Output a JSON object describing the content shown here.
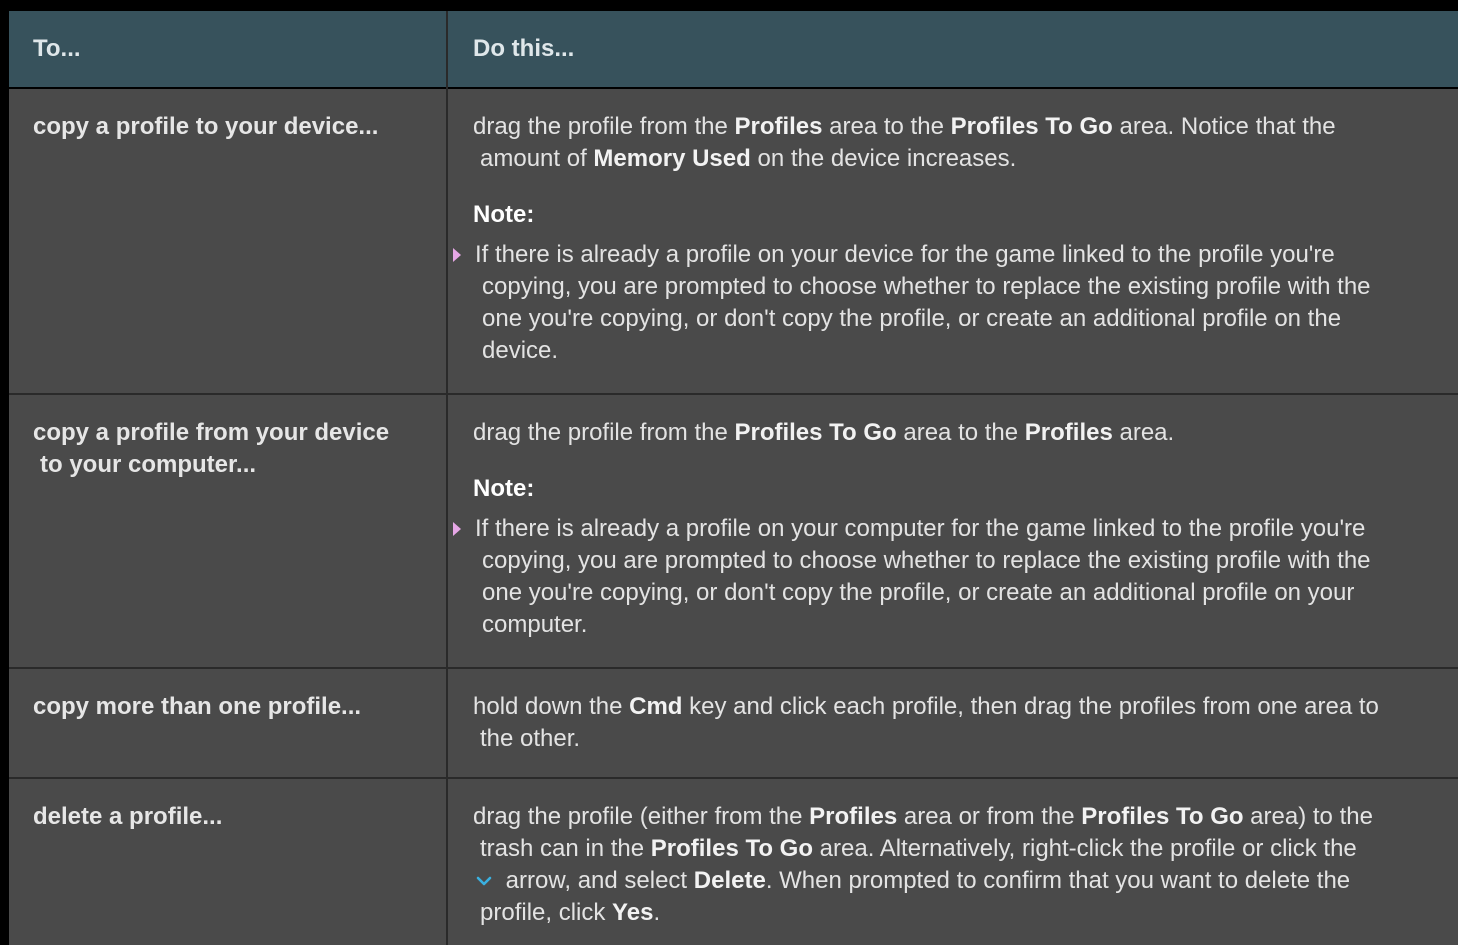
{
  "header": {
    "col1": "To...",
    "col2": "Do this..."
  },
  "rows": [
    {
      "task": "copy a profile to your device...",
      "action": {
        "l1_a": "drag the profile from the ",
        "l1_b": "Profiles",
        "l1_c": " area to the ",
        "l1_d": "Profiles To Go",
        "l1_e": " area. Notice that the",
        "l2_a": "amount of ",
        "l2_b": "Memory Used",
        "l2_c": " on the device increases."
      },
      "note_label": "Note:",
      "note_lines": [
        "If there is already a profile on your device for the game linked to the profile you're",
        "copying, you are prompted to choose whether to replace the existing profile with the",
        "one you're copying, or don't copy the profile, or create an additional profile on the",
        "device."
      ]
    },
    {
      "task_l1": "copy a profile from your device",
      "task_l2": "to your computer...",
      "action": {
        "a": "drag the profile from the ",
        "b": "Profiles To Go",
        "c": " area to the ",
        "d": "Profiles",
        "e": " area."
      },
      "note_label": "Note:",
      "note_lines": [
        "If there is already a profile on your computer for the game linked to the profile you're",
        "copying, you are prompted to choose whether to replace the existing profile with the",
        "one you're copying, or don't copy the profile, or create an additional profile on your",
        "computer."
      ]
    },
    {
      "task": "copy more than one profile...",
      "action": {
        "l1_a": "hold down the ",
        "l1_b": "Cmd",
        "l1_c": " key and click each profile, then drag the profiles from one area to",
        "l2": "the other."
      }
    },
    {
      "task": "delete a profile...",
      "action": {
        "l1_a": "drag the profile (either from the ",
        "l1_b": "Profiles",
        "l1_c": " area or from the ",
        "l1_d": "Profiles To Go",
        "l1_e": " area) to the",
        "l2_a": "trash can in the ",
        "l2_b": "Profiles To Go",
        "l2_c": " area. Alternatively, right-click the profile or click the",
        "l3_a": " arrow, and select ",
        "l3_b": "Delete",
        "l3_c": ". When prompted to confirm that you want to delete the",
        "l4_a": "profile, click ",
        "l4_b": "Yes",
        "l4_c": "."
      },
      "icon": "chevron-down-icon"
    }
  ],
  "colors": {
    "header_bg": "#37525c",
    "row_bg": "#4a4a4a",
    "bullet": "#e6a7e6",
    "chevron": "#3ab0e0"
  }
}
